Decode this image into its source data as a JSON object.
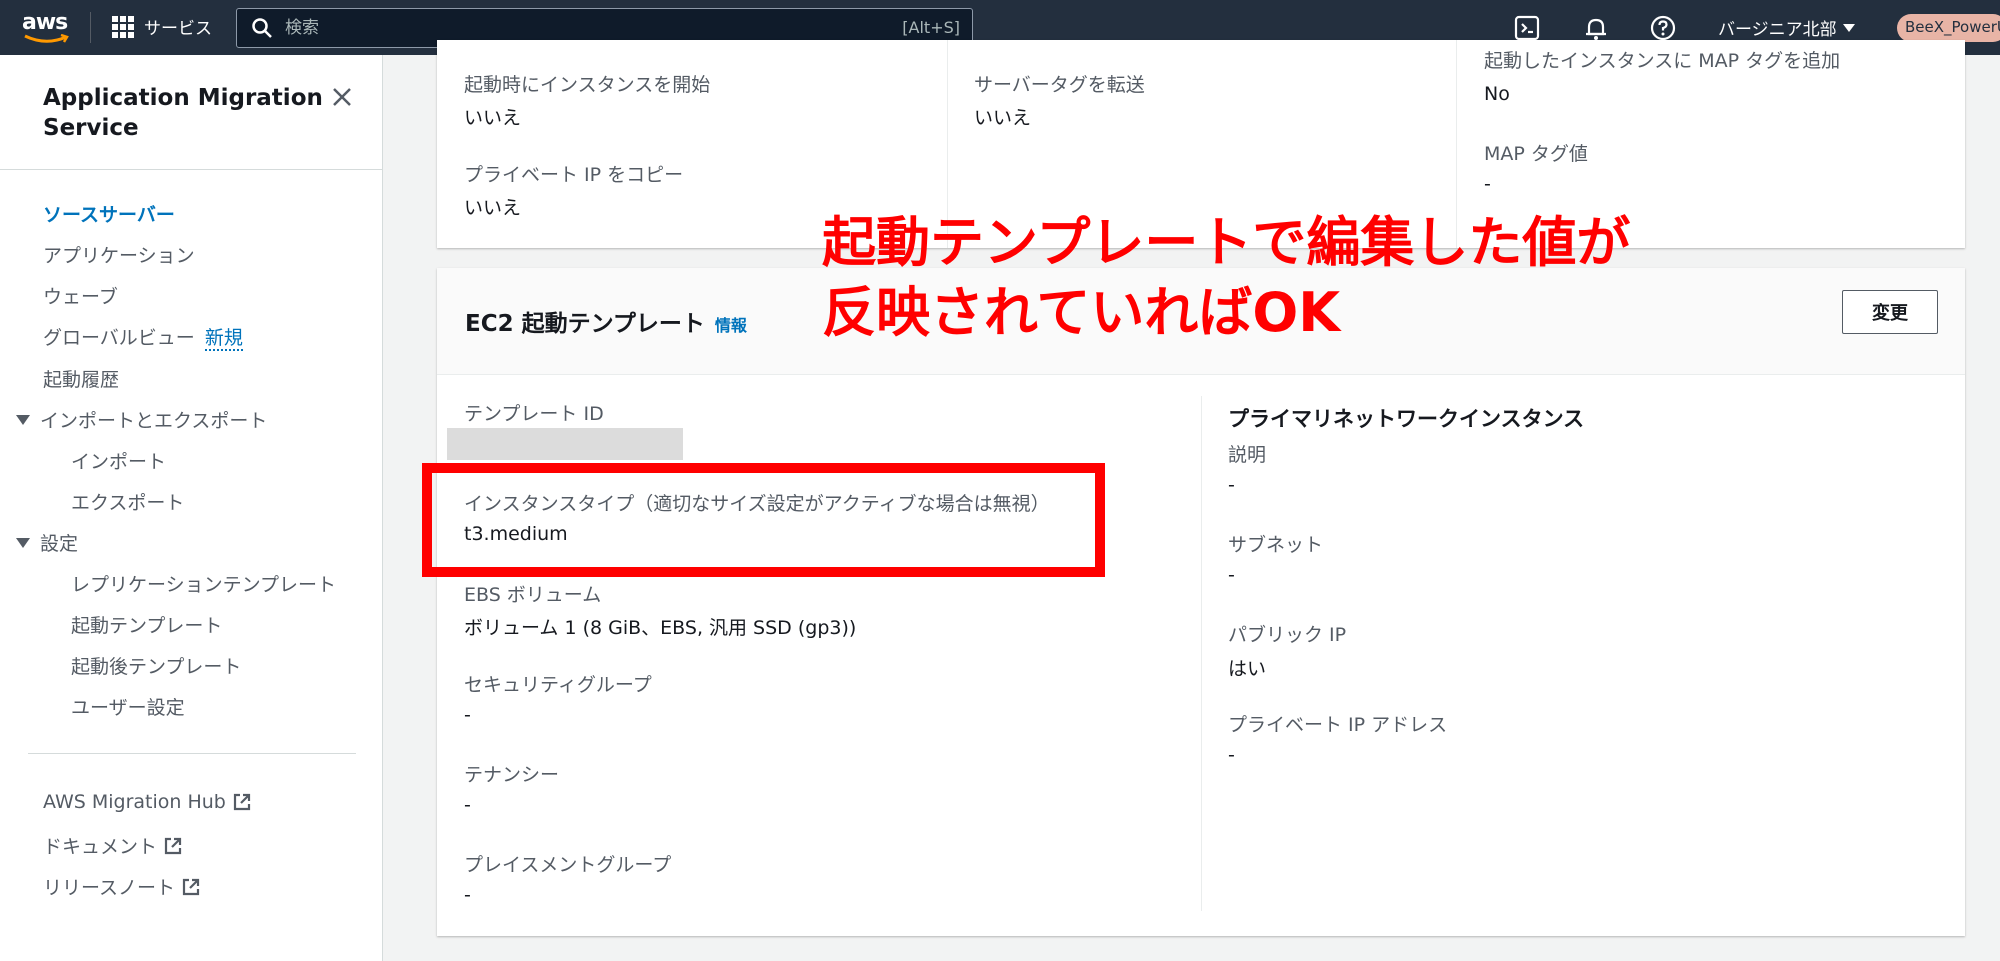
{
  "topnav": {
    "logo": "aws",
    "services_label": "サービス",
    "search_placeholder": "検索",
    "search_shortcut": "[Alt+S]",
    "region": "バージニア北部",
    "account": "BeeX_PowerU"
  },
  "sidebar": {
    "title": "Application Migration Service",
    "items": {
      "source_servers": "ソースサーバー",
      "applications": "アプリケーション",
      "waves": "ウェーブ",
      "global_view": "グローバルビュー",
      "global_view_badge": "新規",
      "launch_history": "起動履歴",
      "import_export": "インポートとエクスポート",
      "import": "インポート",
      "export": "エクスポート",
      "settings": "設定",
      "replication_template": "レプリケーションテンプレート",
      "launch_template": "起動テンプレート",
      "post_launch_template": "起動後テンプレート",
      "user_settings": "ユーザー設定",
      "migration_hub": "AWS Migration Hub",
      "documentation": "ドキュメント",
      "release_notes": "リリースノート"
    }
  },
  "top_card": {
    "start_instance_label": "起動時にインスタンスを開始",
    "start_instance_value": "いいえ",
    "copy_private_ip_label": "プライベート IP をコピー",
    "copy_private_ip_value": "いいえ",
    "transfer_tags_label": "サーバータグを転送",
    "transfer_tags_value": "いいえ",
    "map_tag_add_label": "起動したインスタンスに MAP タグを追加",
    "map_tag_add_value": "No",
    "map_tag_value_label": "MAP タグ値",
    "map_tag_value_value": "-"
  },
  "ec2_card": {
    "title": "EC2 起動テンプレート",
    "info": "情報",
    "change_button": "変更",
    "template_id_label": "テンプレート ID",
    "instance_type_label": "インスタンスタイプ（適切なサイズ設定がアクティブな場合は無視）",
    "instance_type_value": "t3.medium",
    "ebs_label": "EBS ボリューム",
    "ebs_value": "ボリューム 1 (8 GiB、EBS, 汎用 SSD (gp3))",
    "security_group_label": "セキュリティグループ",
    "security_group_value": "-",
    "tenancy_label": "テナンシー",
    "tenancy_value": "-",
    "placement_group_label": "プレイスメントグループ",
    "placement_group_value": "-",
    "primary_network_title": "プライマリネットワークインスタンス",
    "description_label": "説明",
    "description_value": "-",
    "subnet_label": "サブネット",
    "subnet_value": "-",
    "public_ip_label": "パブリック IP",
    "public_ip_value": "はい",
    "private_ip_label": "プライベート IP アドレス",
    "private_ip_value": "-"
  },
  "annotation": {
    "line1": "起動テンプレートで編集した値が",
    "line2": "反映されていればOK",
    "color": "#ff0000"
  }
}
